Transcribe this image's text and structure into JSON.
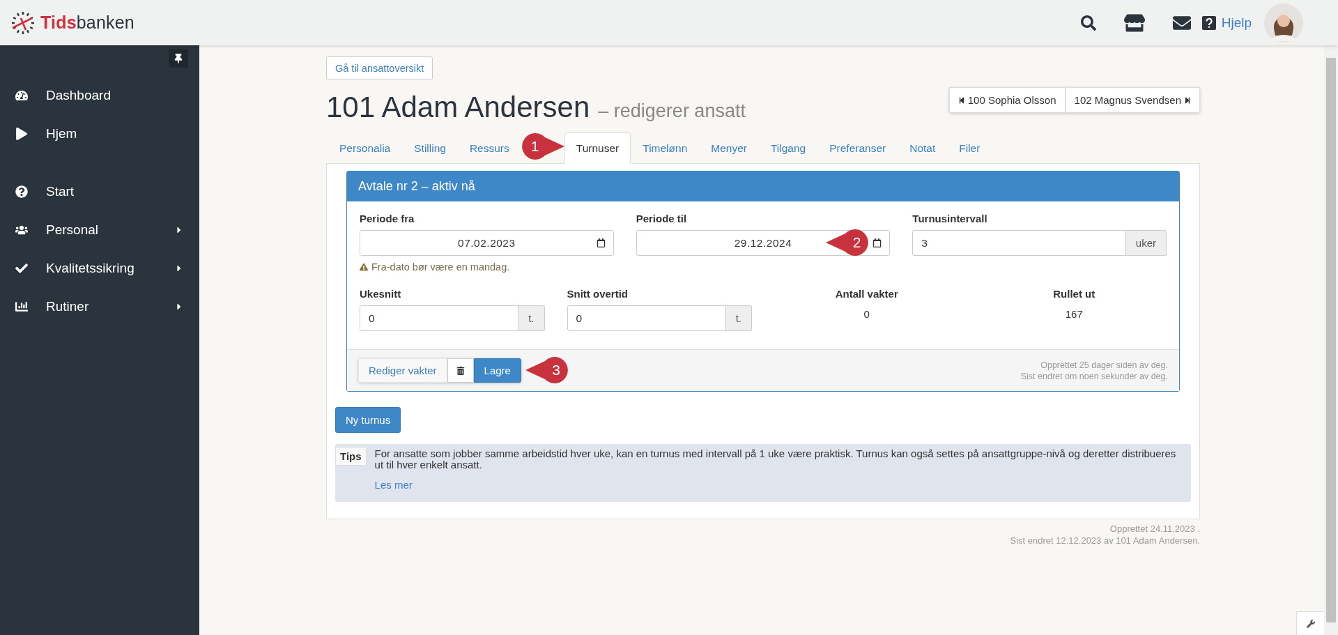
{
  "header": {
    "brand_first": "Tids",
    "brand_second": "banken",
    "help_label": "Hjelp"
  },
  "sidebar": {
    "groups": [
      [
        {
          "label": "Dashboard",
          "has_submenu": false
        },
        {
          "label": "Hjem",
          "has_submenu": false
        }
      ],
      [
        {
          "label": "Start",
          "has_submenu": false
        },
        {
          "label": "Personal",
          "has_submenu": true
        },
        {
          "label": "Kvalitetssikring",
          "has_submenu": true
        },
        {
          "label": "Rutiner",
          "has_submenu": true
        }
      ]
    ]
  },
  "back_button": "Gå til ansattoversikt",
  "title": {
    "name": "101 Adam Andersen",
    "subtitle": "– redigerer ansatt"
  },
  "neighbors": {
    "previous": "100 Sophia Olsson",
    "next": "102 Magnus Svendsen"
  },
  "tabs": [
    {
      "label": "Personalia",
      "selected": false
    },
    {
      "label": "Stilling",
      "selected": false
    },
    {
      "label": "Ressurs",
      "selected": false
    },
    {
      "label": "Turnuser",
      "selected": true
    },
    {
      "label": "Timelønn",
      "selected": false
    },
    {
      "label": "Menyer",
      "selected": false
    },
    {
      "label": "Tilgang",
      "selected": false
    },
    {
      "label": "Preferanser",
      "selected": false
    },
    {
      "label": "Notat",
      "selected": false
    },
    {
      "label": "Filer",
      "selected": false
    }
  ],
  "agreement": {
    "title": "Avtale nr 2 – aktiv nå",
    "period_from": {
      "label": "Periode fra",
      "value": "07.02.2023",
      "warning": "Fra-dato bør være en mandag."
    },
    "period_to": {
      "label": "Periode til",
      "value": "29.12.2024"
    },
    "interval": {
      "label": "Turnusintervall",
      "value": "3",
      "unit": "uker"
    },
    "week_average": {
      "label": "Ukesnitt",
      "value": "0",
      "unit": "t."
    },
    "overtime_average": {
      "label": "Snitt overtid",
      "value": "0",
      "unit": "t."
    },
    "shift_count": {
      "label": "Antall vakter",
      "value": "0"
    },
    "rolled_out": {
      "label": "Rullet ut",
      "value": "167"
    },
    "buttons": {
      "edit": "Rediger vakter",
      "save": "Lagre"
    },
    "created": "Opprettet 25 dager siden av deg.",
    "modified": "Sist endret om noen sekunder av deg."
  },
  "new_button": "Ny turnus",
  "tips": {
    "badge": "Tips",
    "text": "For ansatte som jobber samme arbeidstid hver uke, kan en turnus med intervall på 1 uke være praktisk. Turnus kan også settes på ansattgruppe-nivå og deretter distribueres ut til hver enkelt ansatt.",
    "link": "Les mer"
  },
  "footer": {
    "created": "Opprettet 24.11.2023 .",
    "modified": "Sist endret 12.12.2023 av 101 Adam Andersen."
  },
  "callouts": [
    {
      "label": "1",
      "kind": "right"
    },
    {
      "label": "2",
      "kind": "left"
    },
    {
      "label": "3",
      "kind": "left"
    }
  ]
}
